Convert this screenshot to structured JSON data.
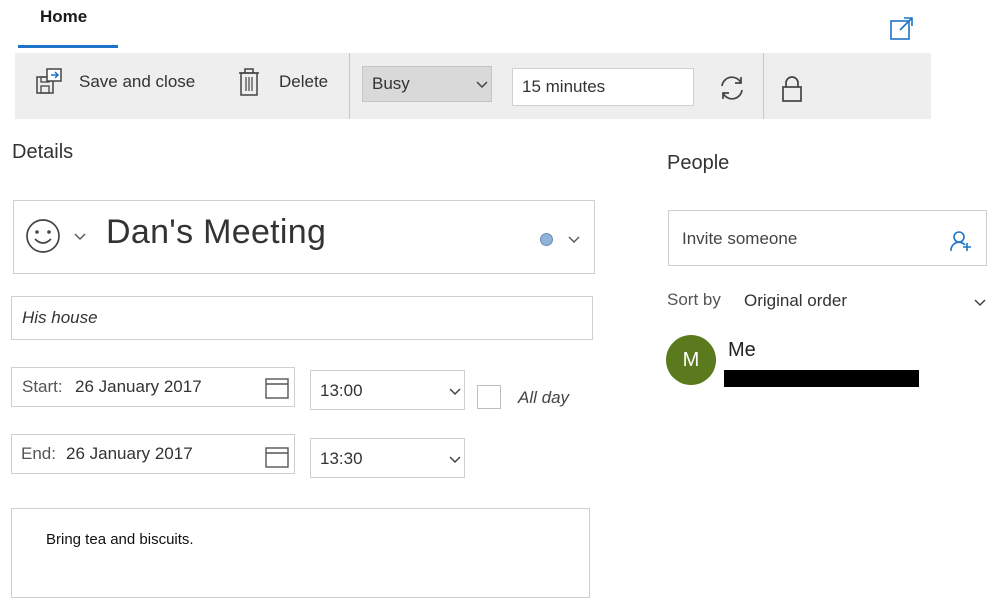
{
  "tabs": {
    "home": "Home"
  },
  "toolbar": {
    "save_close_label": "Save and close",
    "delete_label": "Delete",
    "show_as": "Busy",
    "reminder": "15 minutes"
  },
  "details": {
    "heading": "Details",
    "title": "Dan's Meeting",
    "location": "His house",
    "start_label": "Start:",
    "start_date": "26 January 2017",
    "start_time": "13:00",
    "end_label": "End:",
    "end_date": "26 January 2017",
    "end_time": "13:30",
    "all_day_label": "All day",
    "all_day_checked": false,
    "notes": "Bring tea and biscuits.",
    "category_color": "#8fb3d9"
  },
  "people": {
    "heading": "People",
    "invite_placeholder": "Invite someone",
    "sort_label": "Sort by",
    "sort_value": "Original order",
    "attendees": [
      {
        "initial": "M",
        "name": "Me",
        "avatar_color": "#5b7a1d"
      }
    ]
  },
  "colors": {
    "accent": "#1e73c8",
    "toolbar_bg": "#eeeeee"
  },
  "icons": {
    "popout": "popout-icon",
    "save": "save-close-icon",
    "delete": "trash-icon",
    "repeat": "repeat-icon",
    "lock": "lock-icon",
    "emoji": "smiley-icon",
    "calendar": "calendar-icon",
    "add_person": "add-person-icon"
  }
}
